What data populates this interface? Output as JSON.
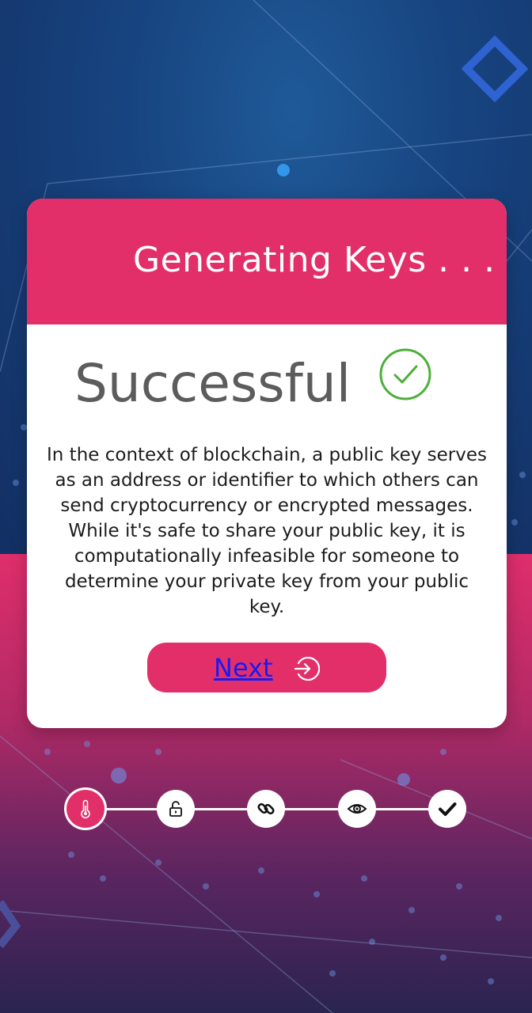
{
  "dialog": {
    "title": "Generating Keys . . .",
    "status": "Successful",
    "status_icon": "check-circle-icon",
    "description": "In the context of blockchain, a public key serves as an address or identifier to which others can send cryptocurrency or encrypted messages. While it's safe to share your public key, it is computationally infeasible for someone to determine your private key from your public key.",
    "next_label": "Next",
    "next_icon": "arrow-right-circle-icon"
  },
  "stepper": {
    "steps": [
      {
        "icon": "thermometer-icon",
        "active": true
      },
      {
        "icon": "unlock-icon",
        "active": false
      },
      {
        "icon": "link-icon",
        "active": false
      },
      {
        "icon": "eye-icon",
        "active": false
      },
      {
        "icon": "check-icon",
        "active": false
      }
    ]
  },
  "colors": {
    "accent": "#e22f6a",
    "success": "#4caf3a",
    "background_top": "#174480",
    "background_bottom": "#df2e6b"
  }
}
